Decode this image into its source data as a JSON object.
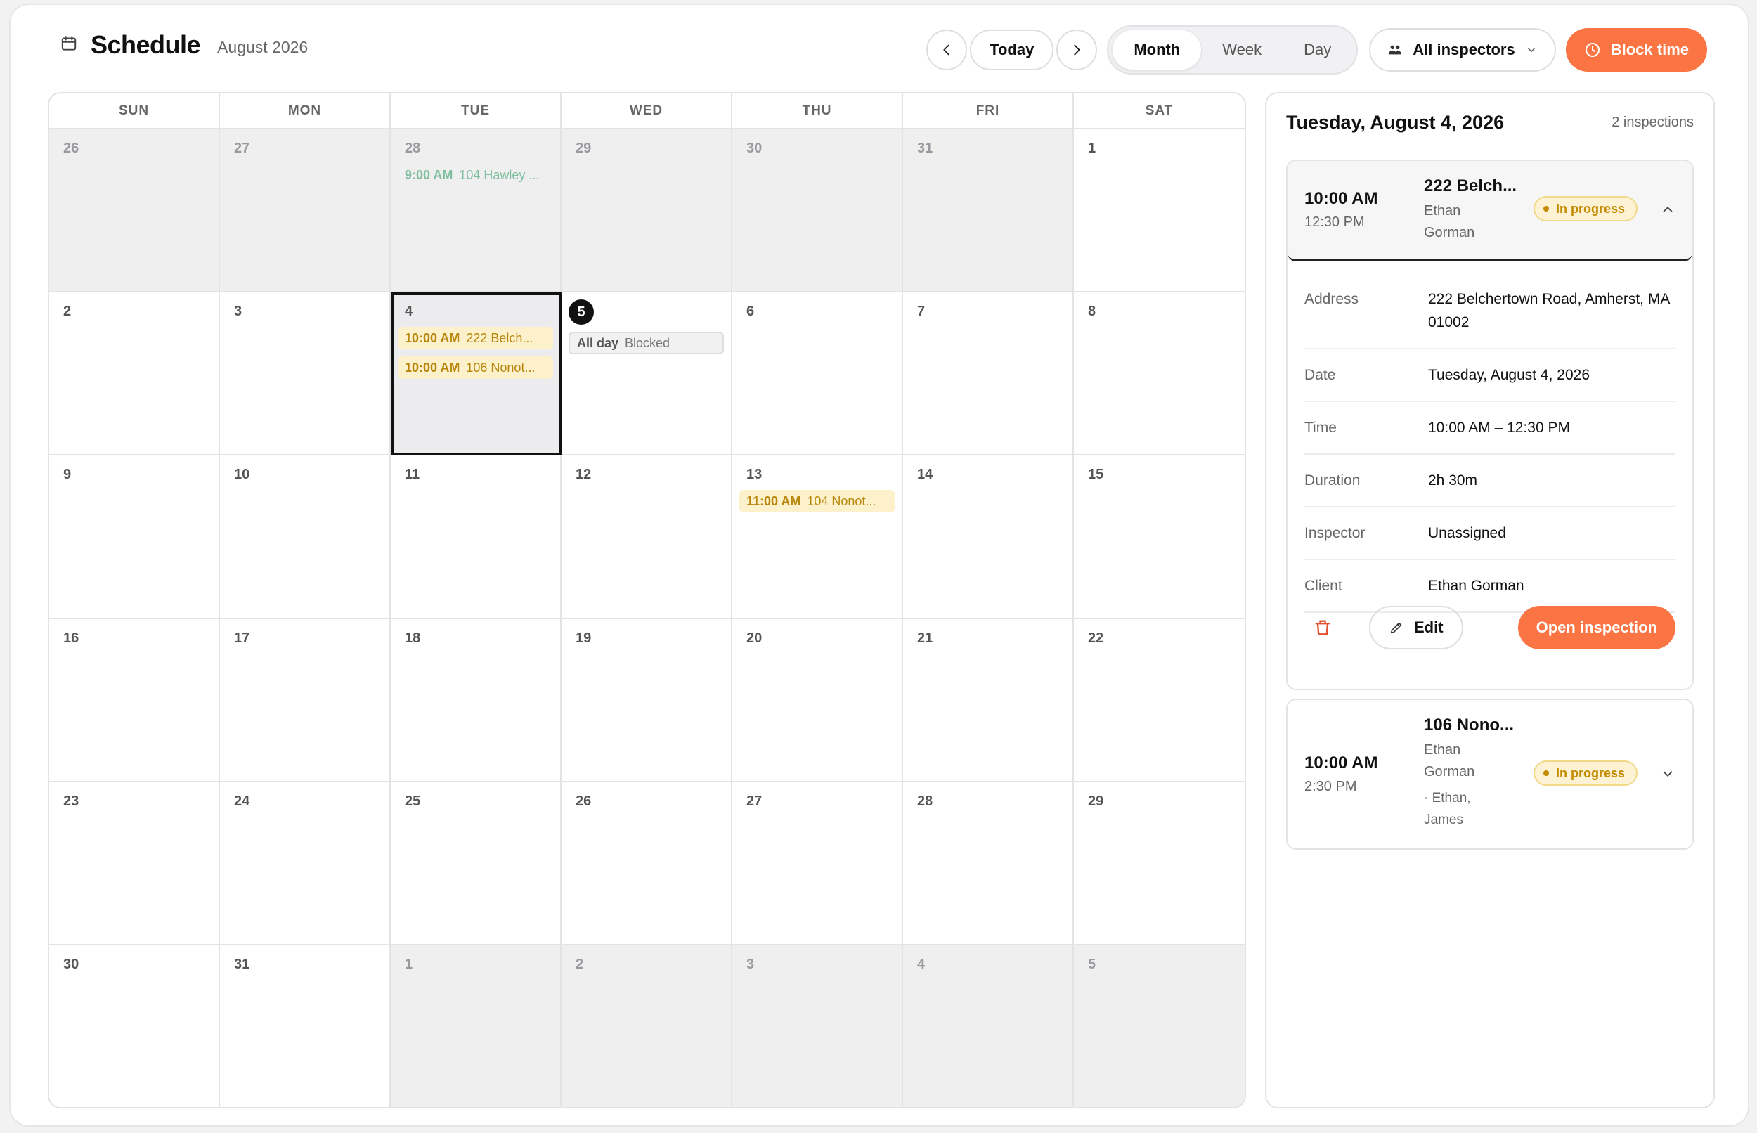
{
  "header": {
    "title": "Schedule",
    "month_label": "August 2026",
    "today_label": "Today",
    "views": [
      "Month",
      "Week",
      "Day"
    ],
    "active_view": "Month",
    "inspectors_label": "All inspectors",
    "block_time_label": "Block time",
    "accent_color": "#fb7544"
  },
  "calendar": {
    "weekdays": [
      "SUN",
      "MON",
      "TUE",
      "WED",
      "THU",
      "FRI",
      "SAT"
    ],
    "days": [
      {
        "n": "26",
        "other": true,
        "events": []
      },
      {
        "n": "27",
        "other": true,
        "events": []
      },
      {
        "n": "28",
        "other": true,
        "events": [
          {
            "time": "9:00 AM",
            "loc": "104 Hawley ...",
            "style": "green"
          }
        ]
      },
      {
        "n": "29",
        "other": true,
        "events": []
      },
      {
        "n": "30",
        "other": true,
        "events": []
      },
      {
        "n": "31",
        "other": true,
        "events": []
      },
      {
        "n": "1",
        "other": false,
        "events": []
      },
      {
        "n": "2",
        "other": false,
        "events": []
      },
      {
        "n": "3",
        "other": false,
        "events": []
      },
      {
        "n": "4",
        "other": false,
        "selected": true,
        "events": [
          {
            "time": "10:00 AM",
            "loc": "222 Belch...",
            "style": "yellow"
          },
          {
            "time": "10:00 AM",
            "loc": "106 Nonot...",
            "style": "yellow"
          }
        ]
      },
      {
        "n": "5",
        "other": false,
        "today": true,
        "events": [
          {
            "time": "All day",
            "loc": "Blocked",
            "style": "gray"
          }
        ]
      },
      {
        "n": "6",
        "other": false,
        "events": []
      },
      {
        "n": "7",
        "other": false,
        "events": []
      },
      {
        "n": "8",
        "other": false,
        "events": []
      },
      {
        "n": "9",
        "other": false,
        "events": []
      },
      {
        "n": "10",
        "other": false,
        "events": []
      },
      {
        "n": "11",
        "other": false,
        "events": []
      },
      {
        "n": "12",
        "other": false,
        "events": []
      },
      {
        "n": "13",
        "other": false,
        "events": [
          {
            "time": "11:00 AM",
            "loc": "104 Nonot...",
            "style": "yellow"
          }
        ]
      },
      {
        "n": "14",
        "other": false,
        "events": []
      },
      {
        "n": "15",
        "other": false,
        "events": []
      },
      {
        "n": "16",
        "other": false,
        "events": []
      },
      {
        "n": "17",
        "other": false,
        "events": []
      },
      {
        "n": "18",
        "other": false,
        "events": []
      },
      {
        "n": "19",
        "other": false,
        "events": []
      },
      {
        "n": "20",
        "other": false,
        "events": []
      },
      {
        "n": "21",
        "other": false,
        "events": []
      },
      {
        "n": "22",
        "other": false,
        "events": []
      },
      {
        "n": "23",
        "other": false,
        "events": []
      },
      {
        "n": "24",
        "other": false,
        "events": []
      },
      {
        "n": "25",
        "other": false,
        "events": []
      },
      {
        "n": "26",
        "other": false,
        "events": []
      },
      {
        "n": "27",
        "other": false,
        "events": []
      },
      {
        "n": "28",
        "other": false,
        "events": []
      },
      {
        "n": "29",
        "other": false,
        "events": []
      },
      {
        "n": "30",
        "other": false,
        "events": []
      },
      {
        "n": "31",
        "other": false,
        "events": []
      },
      {
        "n": "1",
        "other": true,
        "events": []
      },
      {
        "n": "2",
        "other": true,
        "events": []
      },
      {
        "n": "3",
        "other": true,
        "events": []
      },
      {
        "n": "4",
        "other": true,
        "events": []
      },
      {
        "n": "5",
        "other": true,
        "events": []
      }
    ]
  },
  "panel": {
    "date": "Tuesday, August 4, 2026",
    "count": "2 inspections",
    "card1": {
      "start": "10:00 AM",
      "end": "12:30 PM",
      "address": "222 Belch...",
      "client_line1": "Ethan",
      "client_line2": "Gorman",
      "status": "In progress",
      "details": [
        {
          "k": "Address",
          "v": "222 Belchertown Road, Amherst, MA 01002"
        },
        {
          "k": "Date",
          "v": "Tuesday, August 4, 2026"
        },
        {
          "k": "Time",
          "v": "10:00 AM – 12:30 PM"
        },
        {
          "k": "Duration",
          "v": "2h 30m"
        },
        {
          "k": "Inspector",
          "v": "Unassigned"
        },
        {
          "k": "Client",
          "v": "Ethan Gorman"
        }
      ],
      "edit_label": "Edit",
      "open_label": "Open inspection"
    },
    "card2": {
      "start": "10:00 AM",
      "end": "2:30 PM",
      "address": "106 Nono...",
      "client_line1": "Ethan",
      "client_line2": "Gorman",
      "inspectors_line1": "· Ethan,",
      "inspectors_line2": "James",
      "status": "In progress"
    }
  }
}
